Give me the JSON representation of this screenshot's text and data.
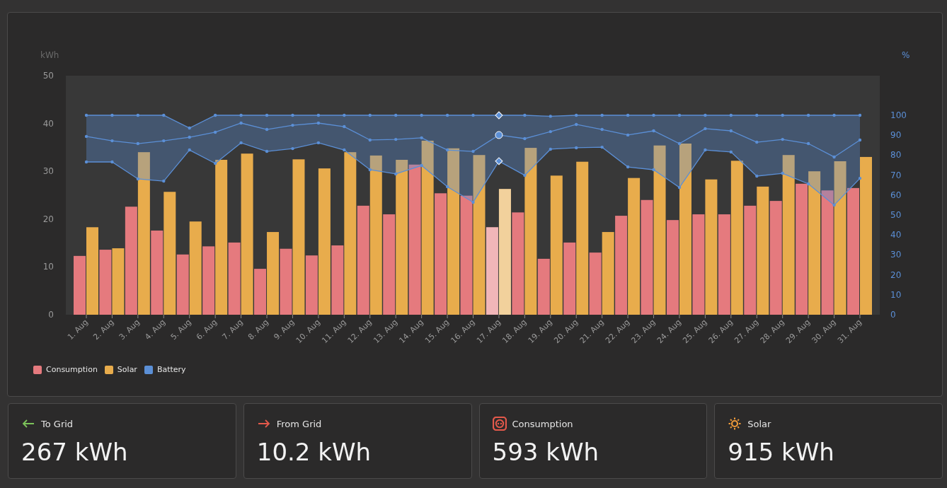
{
  "chart": {
    "chart_data": {
      "type": "bar",
      "ylabel": "kWh",
      "yticks": [
        0,
        10,
        20,
        30,
        40,
        50
      ],
      "ylim": [
        0,
        50
      ],
      "categories": [
        "1. Aug",
        "2. Aug",
        "3. Aug",
        "4. Aug",
        "5. Aug",
        "6. Aug",
        "7. Aug",
        "8. Aug",
        "9. Aug",
        "10. Aug",
        "11. Aug",
        "12. Aug",
        "13. Aug",
        "14. Aug",
        "15. Aug",
        "16. Aug",
        "17. Aug",
        "18. Aug",
        "19. Aug",
        "20. Aug",
        "21. Aug",
        "22. Aug",
        "23. Aug",
        "24. Aug",
        "25. Aug",
        "26. Aug",
        "27. Aug",
        "28. Aug",
        "29. Aug",
        "30. Aug",
        "31. Aug"
      ],
      "series": [
        {
          "name": "Consumption",
          "color": "#e57a7e",
          "values": [
            12.3,
            13.6,
            22.6,
            17.6,
            12.6,
            14.3,
            15.1,
            9.6,
            13.8,
            12.4,
            14.5,
            22.8,
            21.0,
            31.4,
            25.4,
            24.9,
            18.3,
            21.4,
            11.7,
            15.1,
            13.0,
            20.7,
            24.0,
            19.8,
            21.0,
            21.0,
            22.8,
            23.8,
            27.4,
            26.0,
            26.5
          ]
        },
        {
          "name": "Solar",
          "color": "#e8ac4c",
          "values": [
            18.3,
            13.9,
            34.0,
            25.7,
            19.5,
            32.4,
            33.7,
            17.3,
            32.5,
            30.6,
            34.0,
            33.3,
            32.4,
            36.4,
            34.8,
            33.4,
            26.3,
            34.9,
            29.1,
            32.0,
            17.3,
            28.6,
            35.4,
            35.8,
            28.3,
            32.2,
            26.8,
            33.4,
            30.0,
            32.1,
            33.0
          ]
        }
      ],
      "annotations": [
        {
          "x": "17. Aug"
        }
      ]
    }
  },
  "battery_chart": {
    "chart_data": {
      "type": "line",
      "ylabel": "%",
      "yticks": [
        0,
        10,
        20,
        30,
        40,
        50,
        60,
        70,
        80,
        90,
        100
      ],
      "ylim": [
        0,
        100
      ],
      "series": [
        {
          "color": "#5b8fd6",
          "values": [
            100,
            100,
            100,
            100,
            93.6,
            100,
            100,
            100,
            100,
            100,
            100,
            100,
            100,
            100,
            100,
            100,
            100,
            100,
            99.5,
            100,
            100,
            100,
            100,
            100,
            100,
            100,
            100,
            100,
            100,
            100,
            100
          ]
        },
        {
          "name": "Battery",
          "color": "#5b8fd6",
          "values": [
            89.4,
            87.2,
            85.8,
            87.2,
            89.0,
            91.5,
            96.1,
            92.9,
            95.0,
            96.1,
            94.3,
            87.6,
            87.9,
            88.7,
            82.6,
            81.9,
            90.1,
            88.3,
            91.8,
            95.4,
            92.9,
            90.1,
            92.2,
            85.8,
            93.3,
            92.2,
            86.5,
            87.9,
            85.8,
            79.1,
            87.6
          ]
        },
        {
          "color": "#5b8fd6",
          "values": [
            76.6,
            76.6,
            68.1,
            67.0,
            82.6,
            75.9,
            86.2,
            81.9,
            83.3,
            86.2,
            82.6,
            72.7,
            70.6,
            74.8,
            64.2,
            56.4,
            77.0,
            69.9,
            83.0,
            83.7,
            84.0,
            74.1,
            72.7,
            63.8,
            82.6,
            81.6,
            69.5,
            70.9,
            65.6,
            55.0,
            68.4
          ]
        }
      ]
    }
  },
  "cards": [
    {
      "kind": "export",
      "color": "#7cc35a",
      "label": "To Grid",
      "value": "267 kWh"
    },
    {
      "kind": "import",
      "color": "#e4594b",
      "label": "From Grid",
      "value": "10.2 kWh"
    },
    {
      "kind": "consumption",
      "color": "#e4594b",
      "label": "Consumption",
      "value": "593 kWh"
    },
    {
      "kind": "solar",
      "color": "#ee9a3a",
      "label": "Solar",
      "value": "915 kWh"
    }
  ]
}
